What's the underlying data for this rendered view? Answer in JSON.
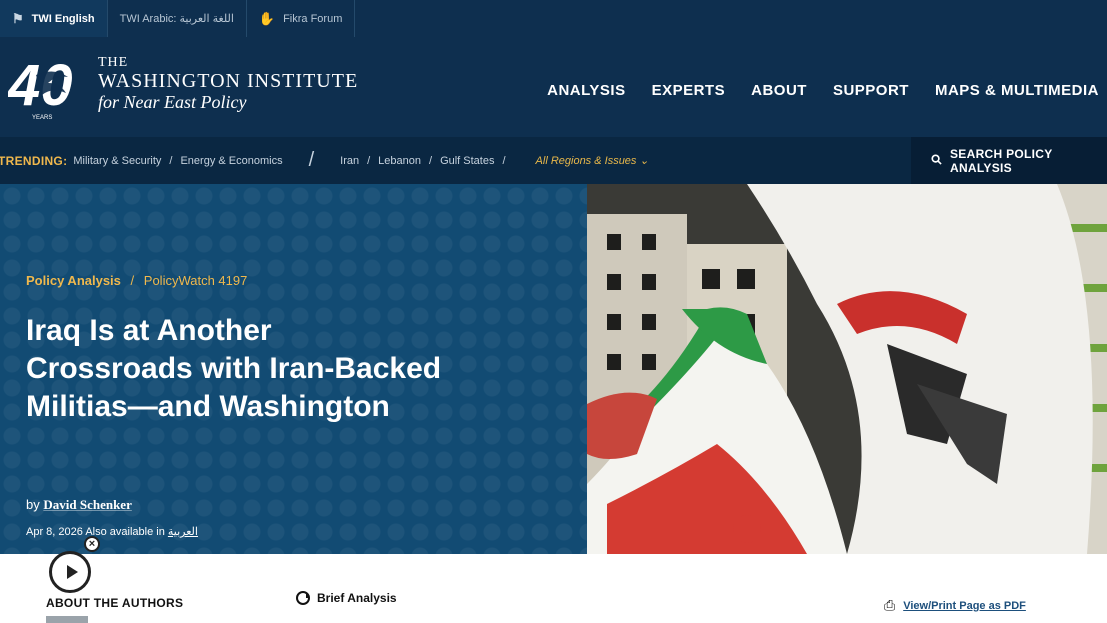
{
  "topbar": {
    "tabs": [
      {
        "label": "TWI English",
        "icon": "bird-icon"
      },
      {
        "label": "TWI Arabic: اللغة العربية",
        "icon": ""
      },
      {
        "label": "Fikra Forum",
        "icon": "handshake-icon"
      }
    ]
  },
  "header": {
    "logo_badge": "40",
    "logo_badge_sub": "YEARS",
    "logo_line1": "THE",
    "logo_line2": "WASHINGTON INSTITUTE",
    "logo_line3": "for Near East Policy",
    "nav": [
      "ANALYSIS",
      "EXPERTS",
      "ABOUT",
      "SUPPORT",
      "MAPS & MULTIMEDIA"
    ]
  },
  "trending": {
    "label": "TRENDING:",
    "topics": [
      "Military & Security",
      "Energy & Economics"
    ],
    "regions": [
      "Iran",
      "Lebanon",
      "Gulf States"
    ],
    "all_regions": "All Regions & Issues ⌄",
    "search_label": "SEARCH POLICY ANALYSIS",
    "search_icon": "search-icon"
  },
  "article": {
    "category": "Policy Analysis",
    "crumb_sep": "/",
    "series": "PolicyWatch 4197",
    "title": "Iraq Is at Another Crossroads with Iran-Backed Militias—and Washington",
    "by": "by",
    "author": "David Schenker",
    "date": "Apr 8, 2026",
    "also_available": "Also available in",
    "arabic_link": "العربية"
  },
  "bottom": {
    "about_authors": "ABOUT THE AUTHORS",
    "brief_analysis": "Brief Analysis",
    "pdf_label": "View/Print Page as PDF",
    "audio_close": "×"
  },
  "colors": {
    "navy": "#0e2f4f",
    "hero_blue": "#124b73",
    "gold": "#f0b84d"
  }
}
